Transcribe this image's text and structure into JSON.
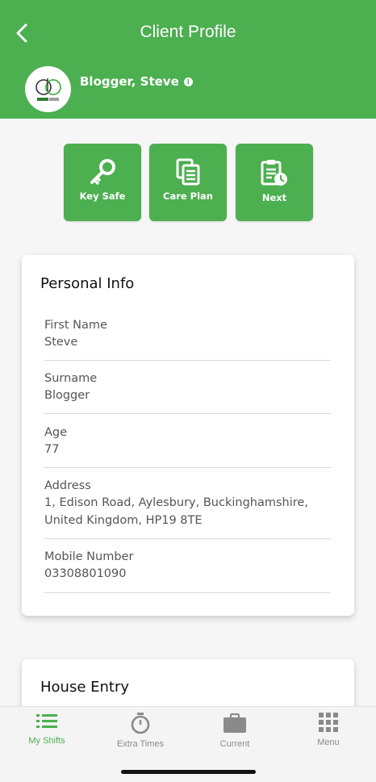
{
  "header": {
    "title": "Client Profile",
    "client_name": "Blogger, Steve",
    "brand_color": "#4caf50"
  },
  "actions": [
    {
      "label": "Key Safe",
      "icon": "key-icon"
    },
    {
      "label": "Care Plan",
      "icon": "documents-icon"
    },
    {
      "label": "Next",
      "icon": "clipboard-clock-icon"
    }
  ],
  "personal_info": {
    "title": "Personal Info",
    "fields": [
      {
        "label": "First Name",
        "value": "Steve"
      },
      {
        "label": "Surname",
        "value": "Blogger"
      },
      {
        "label": "Age",
        "value": "77"
      },
      {
        "label": "Address",
        "value": "1, Edison Road, Aylesbury, Buckinghamshire, United Kingdom, HP19 8TE"
      },
      {
        "label": "Mobile Number",
        "value": "03308801090"
      }
    ]
  },
  "house_entry": {
    "title": "House Entry"
  },
  "tabbar": {
    "tabs": [
      {
        "label": "My Shifts",
        "icon": "list-icon",
        "active": true
      },
      {
        "label": "Extra Times",
        "icon": "stopwatch-icon",
        "active": false
      },
      {
        "label": "Current",
        "icon": "briefcase-icon",
        "active": false
      },
      {
        "label": "Menu",
        "icon": "grid-icon",
        "active": false
      }
    ]
  }
}
